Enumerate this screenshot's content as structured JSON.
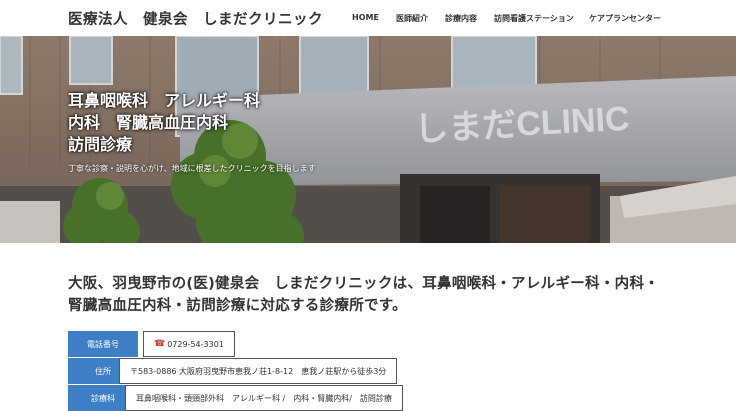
{
  "header": {
    "site_title": "医療法人　健泉会　しまだクリニック",
    "nav": [
      {
        "label": "HOME"
      },
      {
        "label": "医師紹介"
      },
      {
        "label": "診療内容"
      },
      {
        "label": "訪問看護ステーション"
      },
      {
        "label": "ケアプランセンター"
      }
    ]
  },
  "hero": {
    "lines": [
      "耳鼻咽喉科　アレルギー科",
      "内科　腎臓高血圧内科",
      "訪問診療"
    ],
    "subtitle": "丁寧な診察・説明を心がけ、地域に根差したクリニックを目指します",
    "sign_text": "しまだCLINIC"
  },
  "main": {
    "lead": "大阪、羽曳野市の(医)健泉会　しまだクリニックは、耳鼻咽喉科・アレルギー科・内科・腎臓高血圧内科・訪問診療に対応する診療所です。",
    "info": [
      {
        "label": "電話番号",
        "value": "0729-54-3301",
        "icon": "phone-icon"
      },
      {
        "label": "住所",
        "value": "〒583-0886 大阪府羽曳野市恵我ノ荘1-8-12　恵我ノ荘駅から徒歩3分"
      },
      {
        "label": "診療科",
        "value": "耳鼻咽喉科・頭頸部外科　アレルギー科 /　内科・腎臓内科/　訪問診療"
      }
    ]
  },
  "colors": {
    "accent": "#3d7ec4"
  }
}
